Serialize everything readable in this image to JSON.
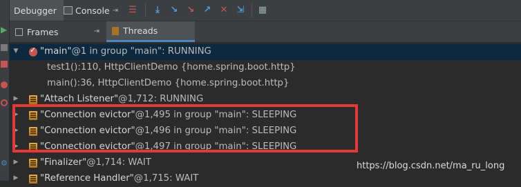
{
  "toolbar": {
    "debugger_label": "Debugger",
    "console_label": "Console"
  },
  "panel_tabs": {
    "frames_label": "Frames",
    "threads_label": "Threads"
  },
  "threads": [
    {
      "name_quoted": "\"main\"",
      "rest": "@1 in group \"main\": RUNNING",
      "expanded": true,
      "selected": true
    },
    {
      "frame": "test1():110, HttpClientDemo {home.spring.boot.http}"
    },
    {
      "frame": "main():36, HttpClientDemo {home.spring.boot.http}"
    },
    {
      "name_quoted": "\"Attach Listener\"",
      "rest": "@1,712: RUNNING"
    },
    {
      "name_quoted": "\"Connection evictor\"",
      "rest": "@1,495 in group \"main\": SLEEPING"
    },
    {
      "name_quoted": "\"Connection evictor\"",
      "rest": "@1,496 in group \"main\": SLEEPING"
    },
    {
      "name_quoted": "\"Connection evictor\"",
      "rest": "@1,497 in group \"main\": SLEEPING"
    },
    {
      "name_quoted": "\"Finalizer\"",
      "rest": "@1,714: WAIT"
    },
    {
      "name_quoted": "\"Reference Handler\"",
      "rest": "@1,715: WAIT"
    }
  ],
  "watermark": "https://blog.csdn.net/ma_ru_long",
  "colors": {
    "background": "#2b2b2b",
    "toolbar": "#3c3f41",
    "selection": "#0d293e",
    "highlight_border": "#e53935"
  }
}
